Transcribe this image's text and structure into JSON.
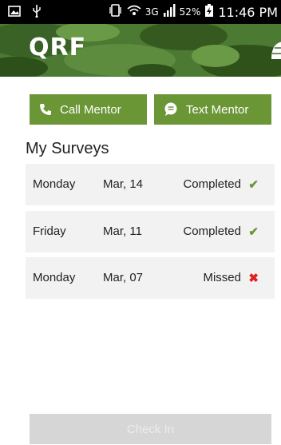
{
  "status_bar": {
    "battery_percent": "52%",
    "time": "11:46 PM",
    "network_type": "3G"
  },
  "header": {
    "logo": "QRF",
    "accent_color": "#3f6b2b"
  },
  "actions": {
    "call_label": "Call Mentor",
    "text_label": "Text Mentor",
    "button_color": "#6a9636"
  },
  "surveys": {
    "title": "My Surveys",
    "rows": [
      {
        "day": "Monday",
        "date": "Mar, 14",
        "status": "Completed",
        "mark": "✔"
      },
      {
        "day": "Friday",
        "date": "Mar, 11",
        "status": "Completed",
        "mark": "✔"
      },
      {
        "day": "Monday",
        "date": "Mar, 07",
        "status": "Missed",
        "mark": "✖"
      }
    ]
  },
  "checkin": {
    "label": "Check In",
    "disabled": true
  }
}
